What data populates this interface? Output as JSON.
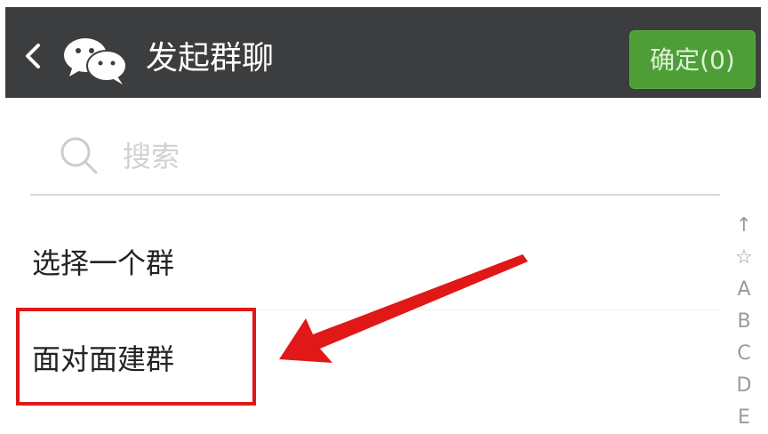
{
  "header": {
    "title": "发起群聊",
    "confirm_label": "确定(0)",
    "bg_color": "#3c3d3f",
    "confirm_color": "#4d9e36",
    "icons": [
      "back-icon",
      "wechat-logo-icon"
    ]
  },
  "search": {
    "placeholder": "搜索",
    "icon": "search-icon"
  },
  "list": {
    "items": [
      {
        "label": "选择一个群"
      },
      {
        "label": "面对面建群"
      }
    ]
  },
  "index_bar": {
    "entries": [
      "↑",
      "☆",
      "A",
      "B",
      "C",
      "D",
      "E"
    ]
  },
  "annotation": {
    "highlight_color": "#e01818",
    "icon": "red-arrow-icon"
  }
}
